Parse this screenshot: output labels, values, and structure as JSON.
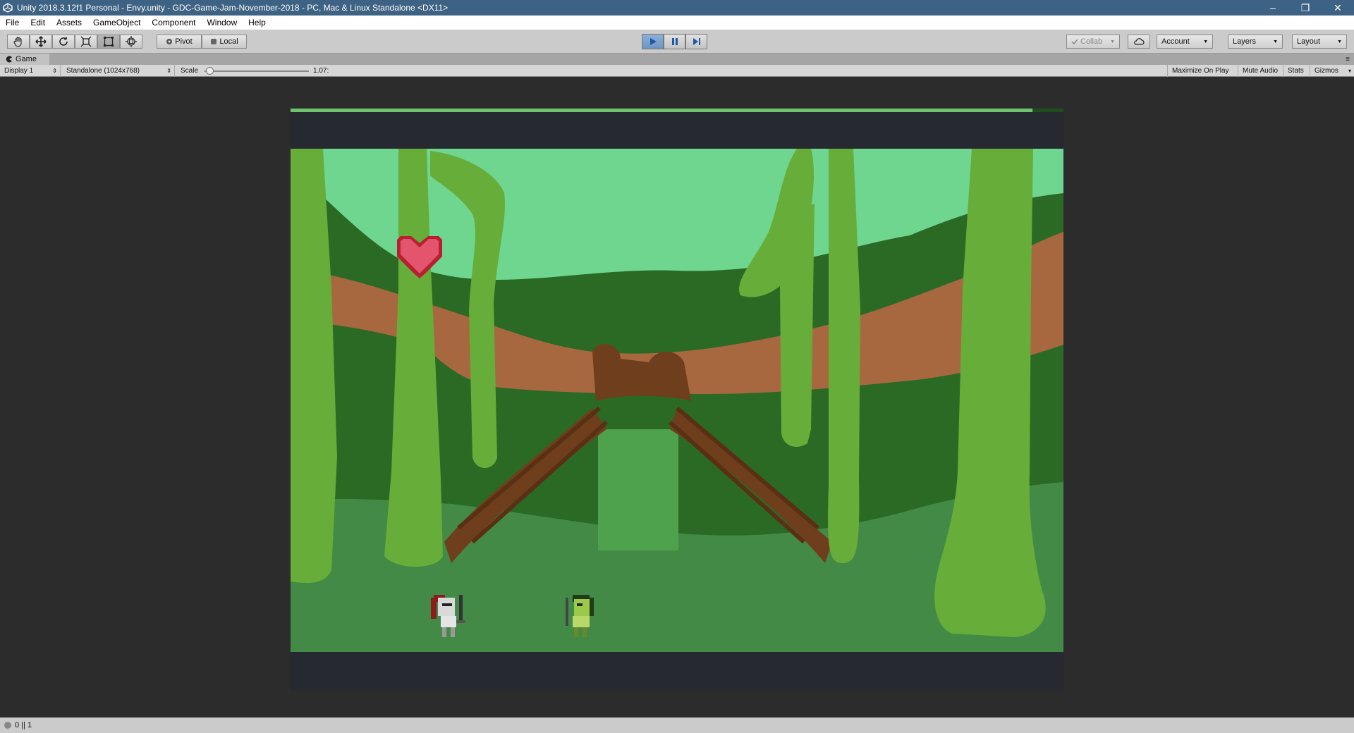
{
  "window": {
    "title": "Unity 2018.3.12f1 Personal - Envy.unity - GDC-Game-Jam-November-2018 - PC, Mac & Linux Standalone <DX11>",
    "minimize": "–",
    "restore": "❐",
    "close": "✕"
  },
  "menu": [
    "File",
    "Edit",
    "Assets",
    "GameObject",
    "Component",
    "Window",
    "Help"
  ],
  "toolbar": {
    "tools": [
      "hand-tool",
      "move-tool",
      "rotate-tool",
      "scale-tool",
      "rect-tool",
      "transform-tool"
    ],
    "active_tool": "rect-tool",
    "pivot_label": "Pivot",
    "local_label": "Local",
    "play_state": "playing",
    "collab_label": "Collab",
    "account_label": "Account",
    "layers_label": "Layers",
    "layout_label": "Layout"
  },
  "game_tab": {
    "label": "Game"
  },
  "game_bar": {
    "display": "Display 1",
    "resolution": "Standalone (1024x768)",
    "scale_label": "Scale",
    "scale_value": "1.07:",
    "scale_fraction": 0.05,
    "maximize_on_play": "Maximize On Play",
    "mute_audio": "Mute Audio",
    "stats": "Stats",
    "gizmos": "Gizmos"
  },
  "game_view": {
    "health_bar_fraction": 0.96,
    "colors": {
      "sky": "#6fd690",
      "dark_forest": "#2b6a25",
      "trail": "#a8683f",
      "ground": "#438a47",
      "vine": "#67ad3a",
      "bridge": "#6f3e1c",
      "heart": "#e3556c",
      "letterbox": "#262a30"
    }
  },
  "status_bar": {
    "text": "0 || 1"
  }
}
